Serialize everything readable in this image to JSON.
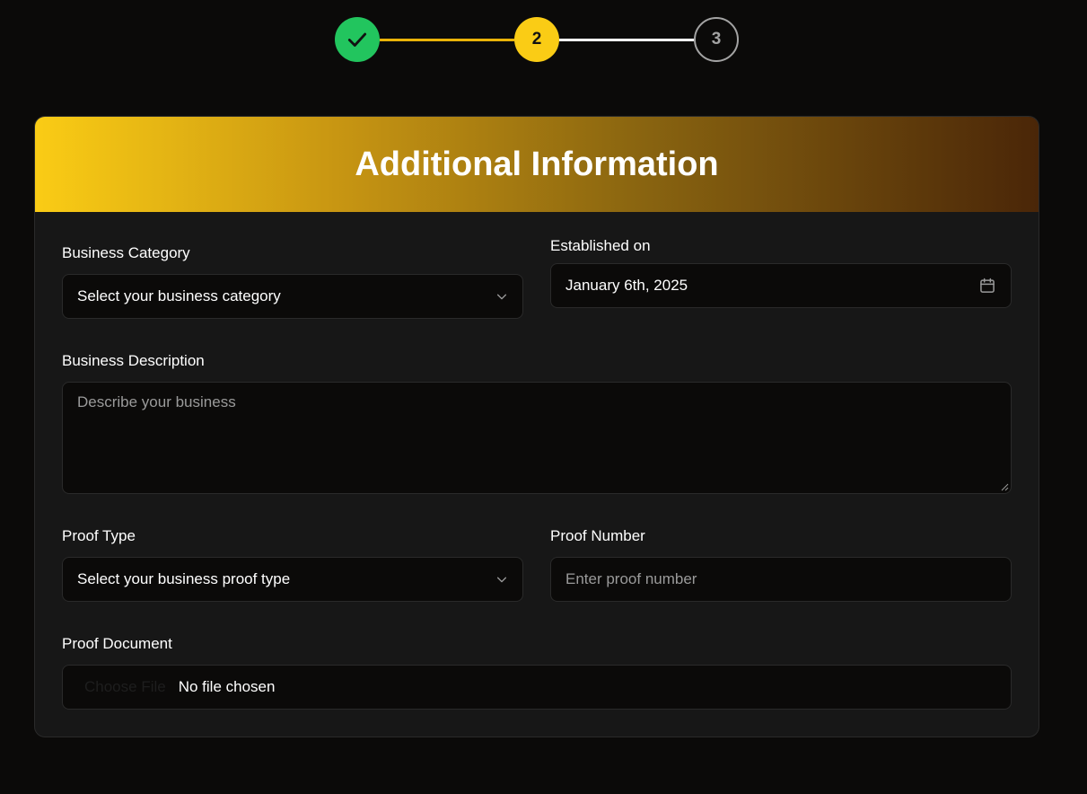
{
  "stepper": {
    "steps": [
      {
        "state": "completed",
        "icon": "check-icon"
      },
      {
        "state": "current",
        "number": "2"
      },
      {
        "state": "pending",
        "number": "3"
      }
    ],
    "colors": {
      "completed": "#22c55e",
      "current": "#facc15",
      "pending": "#a3a3a3"
    }
  },
  "card": {
    "title": "Additional Information"
  },
  "form": {
    "business_category": {
      "label": "Business Category",
      "value": "Select your business category",
      "icon": "chevron-down-icon"
    },
    "established_on": {
      "label": "Established on",
      "value": "January 6th, 2025",
      "icon": "calendar-icon"
    },
    "business_description": {
      "label": "Business Description",
      "placeholder": "Describe your business"
    },
    "proof_type": {
      "label": "Proof Type",
      "value": "Select your business proof type",
      "icon": "chevron-down-icon"
    },
    "proof_number": {
      "label": "Proof Number",
      "placeholder": "Enter proof number"
    },
    "proof_document": {
      "label": "Proof Document",
      "button_label": "Choose File",
      "status": "No file chosen"
    }
  }
}
